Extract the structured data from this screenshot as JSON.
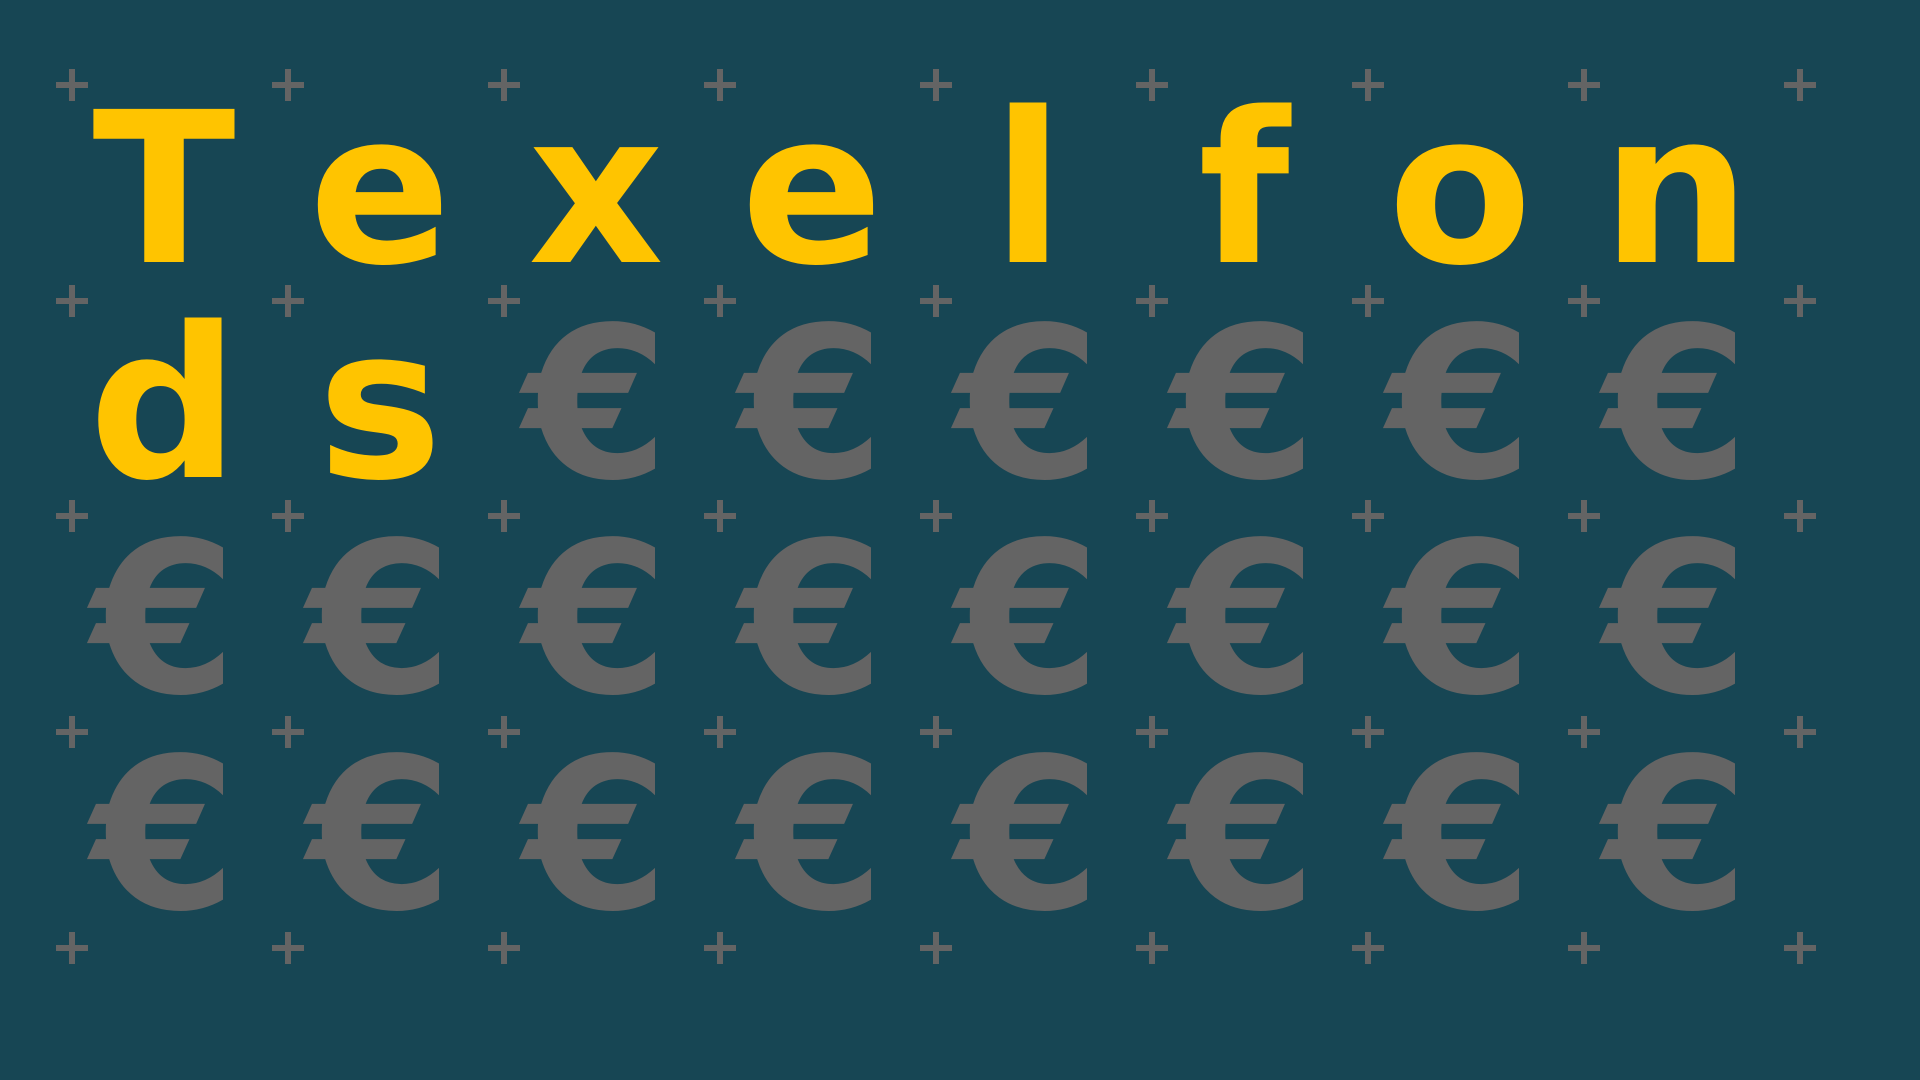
{
  "title": "Texel fonds",
  "letters": [
    "T",
    "e",
    "x",
    "e",
    "l",
    "f",
    "o",
    "n",
    "d",
    "s"
  ],
  "euro_symbol": "€",
  "colors": {
    "background": "#174654",
    "letters": "#FFC400",
    "euros": "#646464",
    "plus_marks": "#646464"
  },
  "grid": {
    "columns": 8,
    "rows": 4,
    "euro_count": 22,
    "plus_marker_icon": "plus-icon"
  }
}
